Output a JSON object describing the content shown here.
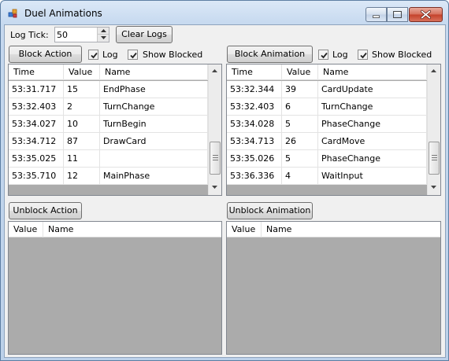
{
  "window": {
    "title": "Duel Animations",
    "accent_color": "#c4412a"
  },
  "log_tick": {
    "label": "Log Tick:",
    "value": "50"
  },
  "clear_logs_label": "Clear Logs",
  "left": {
    "block_label": "Block Action",
    "log_label": "Log",
    "show_blocked_label": "Show Blocked",
    "log_checked": true,
    "show_blocked_checked": true,
    "columns": [
      "Time",
      "Value",
      "Name"
    ],
    "rows": [
      [
        "53:31.717",
        "15",
        "EndPhase"
      ],
      [
        "53:32.403",
        "2",
        "TurnChange"
      ],
      [
        "53:34.027",
        "10",
        "TurnBegin"
      ],
      [
        "53:34.712",
        "87",
        "DrawCard"
      ],
      [
        "53:35.025",
        "11",
        ""
      ],
      [
        "53:35.710",
        "12",
        "MainPhase"
      ]
    ],
    "unblock_label": "Unblock Action",
    "blocked_columns": [
      "Value",
      "Name"
    ]
  },
  "right": {
    "block_label": "Block Animation",
    "log_label": "Log",
    "show_blocked_label": "Show Blocked",
    "log_checked": true,
    "show_blocked_checked": true,
    "columns": [
      "Time",
      "Value",
      "Name"
    ],
    "rows": [
      [
        "53:32.344",
        "39",
        "CardUpdate"
      ],
      [
        "53:32.403",
        "6",
        "TurnChange"
      ],
      [
        "53:34.028",
        "5",
        "PhaseChange"
      ],
      [
        "53:34.713",
        "26",
        "CardMove"
      ],
      [
        "53:35.026",
        "5",
        "PhaseChange"
      ],
      [
        "53:36.336",
        "4",
        "WaitInput"
      ]
    ],
    "unblock_label": "Unblock Animation",
    "blocked_columns": [
      "Value",
      "Name"
    ]
  }
}
